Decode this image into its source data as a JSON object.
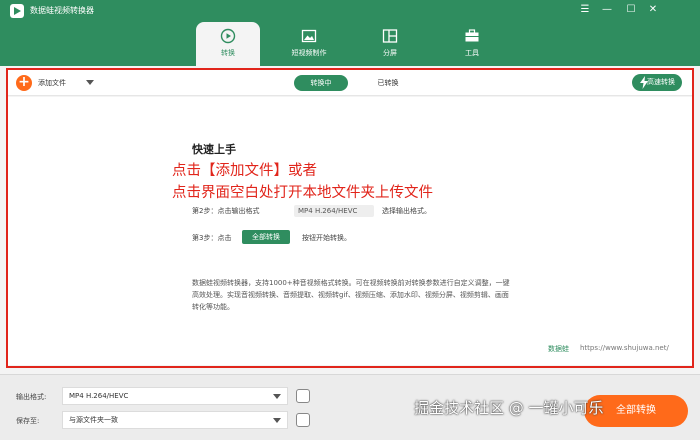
{
  "app": {
    "title": "数据蛙视频转换器"
  },
  "window_controls": [
    "☰",
    "—",
    "☐",
    "✕"
  ],
  "tabs": [
    {
      "label": "转换",
      "icon": "convert-icon",
      "active": true
    },
    {
      "label": "短视频制作",
      "icon": "image-icon",
      "active": false
    },
    {
      "label": "分屏",
      "icon": "split-icon",
      "active": false
    },
    {
      "label": "工具",
      "icon": "toolbox-icon",
      "active": false
    }
  ],
  "toolbar": {
    "add_label": "添加文件",
    "converting_label": "转换中",
    "converted_label": "已转换",
    "fast_label": "高速转换"
  },
  "guide": {
    "title": "快速上手",
    "step2_label": "第2步：点击输出格式",
    "step2_value": "MP4 H.264/HEVC",
    "step2_hint": "选择输出格式。",
    "step3_label": "第3步：点击",
    "step3_button": "全部转换",
    "step3_hint": "按钮开始转换。",
    "description": "数据蛙视频转换器，支持1000+种音视频格式转换。可在视频转换前对转换参数进行自定义调整，一键高效处理。实现音视频转换、音频提取、视频转gif、视频压缩、添加水印、视频分屏、视频剪辑、画面转化等功能。"
  },
  "overlay": {
    "line1": "点击【添加文件】或者",
    "line2": "点击界面空白处打开本地文件夹上传文件"
  },
  "brand": {
    "name": "数据蛙",
    "site": "https://www.shujuwa.net/"
  },
  "bottom": {
    "format_label": "输出格式:",
    "format_value": "MP4 H.264/HEVC",
    "save_label": "保存至:",
    "save_value": "与源文件夹一致",
    "start_label": "全部转换"
  },
  "watermark": "掘金技术社区 @ 一罐小可乐",
  "colors": {
    "brand_green": "#2f8d5f",
    "accent_orange": "#ff6a1a",
    "annotation_red": "#e1251b"
  }
}
